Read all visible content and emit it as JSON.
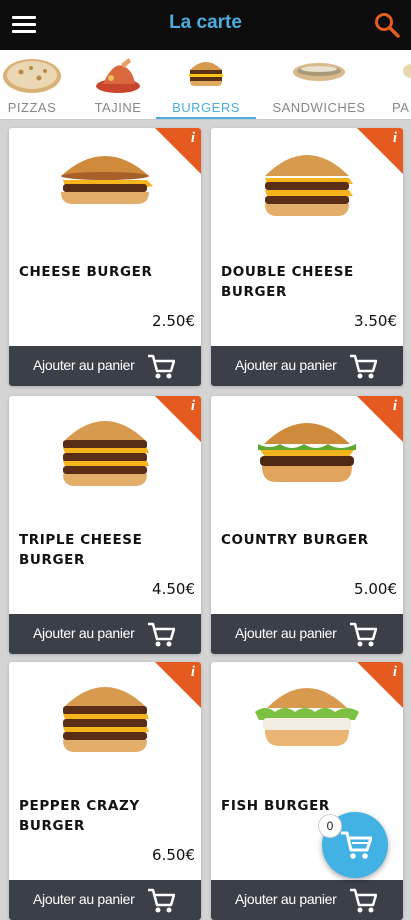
{
  "header": {
    "title": "La carte"
  },
  "categories": [
    {
      "label": "PIZZAS",
      "icon": "pizza-icon"
    },
    {
      "label": "TAJINE",
      "icon": "tajine-icon"
    },
    {
      "label": "BURGERS",
      "icon": "burger-icon",
      "active": true
    },
    {
      "label": "SANDWICHES",
      "icon": "sandwich-icon"
    },
    {
      "label": "PA",
      "icon": "category-icon"
    }
  ],
  "products": [
    {
      "name": "CHEESE BURGER",
      "price": "2.50€",
      "button": "Ajouter au panier"
    },
    {
      "name": "DOUBLE CHEESE BURGER",
      "price": "3.50€",
      "button": "Ajouter au panier"
    },
    {
      "name": "TRIPLE CHEESE BURGER",
      "price": "4.50€",
      "button": "Ajouter au panier"
    },
    {
      "name": "COUNTRY BURGER",
      "price": "5.00€",
      "button": "Ajouter au panier"
    },
    {
      "name": "PEPPER CRAZY BURGER",
      "price": "6.50€",
      "button": "Ajouter au panier"
    },
    {
      "name": "FISH BURGER",
      "price": "",
      "button": "Ajouter au panier"
    }
  ],
  "info_label": "i",
  "cart": {
    "count": "0"
  },
  "colors": {
    "accent": "#4aaee0",
    "badge": "#e55b1f",
    "button": "#3b3f47",
    "fab": "#42b1e3"
  }
}
